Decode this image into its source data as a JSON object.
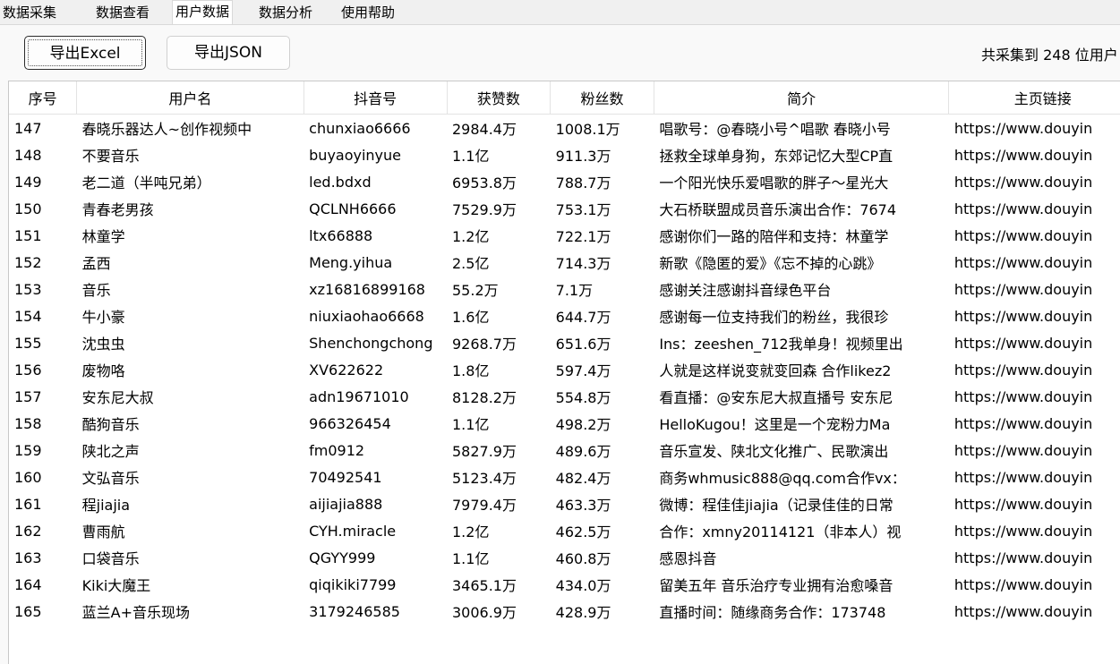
{
  "tabs": [
    {
      "label": "数据采集"
    },
    {
      "label": "数据查看"
    },
    {
      "label": "用户数据"
    },
    {
      "label": "数据分析"
    },
    {
      "label": "使用帮助"
    }
  ],
  "toolbar": {
    "export_excel_label": "导出Excel",
    "export_json_label": "导出JSON",
    "count_text": "共采集到 248 位用户"
  },
  "table": {
    "columns": [
      "序号",
      "用户名",
      "抖音号",
      "获赞数",
      "粉丝数",
      "简介",
      "主页链接"
    ],
    "rows": [
      [
        "147",
        "春晓乐器达人~创作视频中",
        "chunxiao6666",
        "2984.4万",
        "1008.1万",
        "唱歌号：@春晓小号^唱歌 春晓小号",
        "https://www.douyin"
      ],
      [
        "148",
        "不要音乐",
        "buyaoyinyue",
        "1.1亿",
        "911.3万",
        "拯救全球单身狗，东郊记忆大型CP直",
        "https://www.douyin"
      ],
      [
        "149",
        "老二道（半吨兄弟）",
        "led.bdxd",
        "6953.8万",
        "788.7万",
        "一个阳光快乐爱唱歌的胖子～星光大",
        "https://www.douyin"
      ],
      [
        "150",
        "青春老男孩",
        "QCLNH6666",
        "7529.9万",
        "753.1万",
        "大石桥联盟成员音乐演出合作：7674",
        "https://www.douyin"
      ],
      [
        "151",
        "林童学",
        "ltx66888",
        "1.2亿",
        "722.1万",
        "感谢你们一路的陪伴和支持：林童学",
        "https://www.douyin"
      ],
      [
        "152",
        "孟西",
        "Meng.yihua",
        "2.5亿",
        "714.3万",
        "新歌《隐匿的爱》《忘不掉的心跳》",
        "https://www.douyin"
      ],
      [
        "153",
        "音乐",
        "xz16816899168",
        "55.2万",
        "7.1万",
        "感谢关注感谢抖音绿色平台",
        "https://www.douyin"
      ],
      [
        "154",
        "牛小豪",
        "niuxiaohao6668",
        "1.6亿",
        "644.7万",
        "感谢每一位支持我们的粉丝，我很珍",
        "https://www.douyin"
      ],
      [
        "155",
        "沈虫虫",
        "Shenchongchong",
        "9268.7万",
        "651.6万",
        "Ins：zeeshen_712我单身！视频里出",
        "https://www.douyin"
      ],
      [
        "156",
        "废物咯",
        "XV622622",
        "1.8亿",
        "597.4万",
        "人就是这样说变就变回森 合作likez2",
        "https://www.douyin"
      ],
      [
        "157",
        "安东尼大叔",
        "adn19671010",
        "8128.2万",
        "554.8万",
        "看直播：@安东尼大叔直播号 安东尼",
        "https://www.douyin"
      ],
      [
        "158",
        "酷狗音乐",
        "966326454",
        "1.1亿",
        "498.2万",
        "HelloKugou！这里是一个宠粉力Ma",
        "https://www.douyin"
      ],
      [
        "159",
        "陕北之声",
        "fm0912",
        "5827.9万",
        "489.6万",
        "音乐宣发、陕北文化推广、民歌演出",
        "https://www.douyin"
      ],
      [
        "160",
        "文弘音乐",
        "70492541",
        "5123.4万",
        "482.4万",
        "商务whmusic888@qq.com合作vx：",
        "https://www.douyin"
      ],
      [
        "161",
        "程jiajia",
        "aijiajia888",
        "7979.4万",
        "463.3万",
        "微博：程佳佳jiajia（记录佳佳的日常",
        "https://www.douyin"
      ],
      [
        "162",
        "曹雨航",
        "CYH.miracle",
        "1.2亿",
        "462.5万",
        "合作：xmny20114121（非本人）视",
        "https://www.douyin"
      ],
      [
        "163",
        "口袋音乐",
        "QGYY999",
        "1.1亿",
        "460.8万",
        "感恩抖音",
        "https://www.douyin"
      ],
      [
        "164",
        "Kiki大魔王",
        "qiqikiki7799",
        "3465.1万",
        "434.0万",
        "留美五年 音乐治疗专业拥有治愈嗓音",
        "https://www.douyin"
      ],
      [
        "165",
        "蓝兰A+音乐现场",
        "3179246585",
        "3006.9万",
        "428.9万",
        "直播时间：随缘商务合作：173748",
        "https://www.douyin"
      ]
    ]
  }
}
